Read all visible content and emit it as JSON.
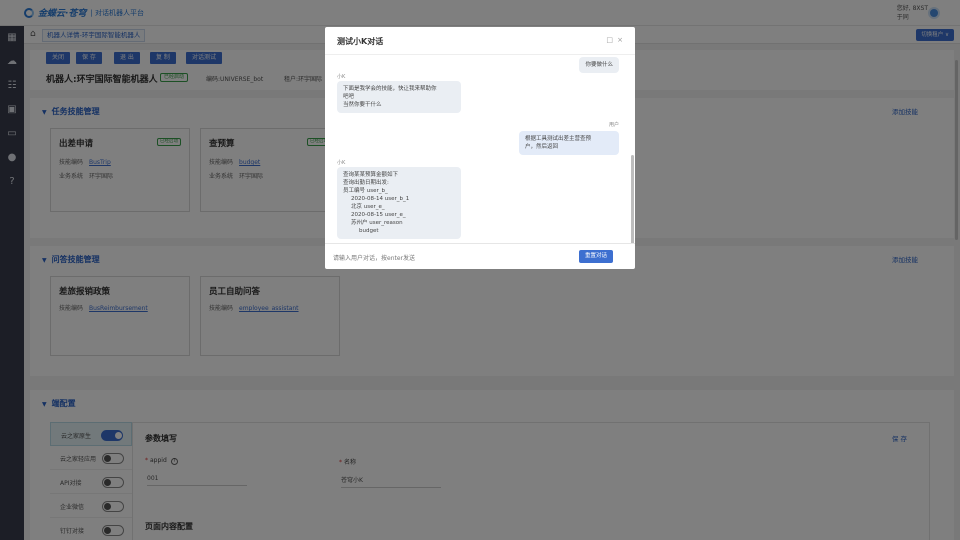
{
  "topbar": {
    "logo_text": "金蝶云·苍穹",
    "logo_sub": "| 对话机器人平台",
    "user_line1": "您好, 8XST",
    "user_line2": "于同"
  },
  "sidebar": {
    "icons": [
      "grid-icon",
      "cloud-icon",
      "database-icon",
      "bot-icon",
      "monitor-icon",
      "user-icon",
      "help-icon"
    ]
  },
  "header": {
    "tab_label": "机器人详情-环宇国际智能机器人",
    "switch_button": "切换租户 ∨"
  },
  "toolbar": {
    "buttons": [
      "关闭",
      "保 存",
      "退 出",
      "复 制",
      "对话测试"
    ],
    "robot_title": "机器人:环宇国际智能机器人",
    "status": "已经启动",
    "code_label": "编码:UNIVERSE_bot",
    "tenant_label": "租户:环宇国际"
  },
  "task_panel": {
    "title": "任务技能管理",
    "add_link": "添加技能",
    "cards": [
      {
        "title": "出差申请",
        "tag": "已经启动",
        "code_label": "技能编码",
        "code": "BusTrip",
        "system_label": "业务系统",
        "system": "环宇国际"
      },
      {
        "title": "查预算",
        "tag": "已经启动",
        "code_label": "技能编码",
        "code": "budget",
        "system_label": "业务系统",
        "system": "环宇国际"
      }
    ]
  },
  "qa_panel": {
    "title": "问答技能管理",
    "add_link": "添加技能",
    "cards": [
      {
        "title": "差旅报销政策",
        "code_label": "技能编码",
        "code": "BusReimbursement"
      },
      {
        "title": "员工自助问答",
        "code_label": "技能编码",
        "code": "employee_assistant"
      }
    ]
  },
  "config_panel": {
    "title": "端配置",
    "items": [
      {
        "label": "云之家原生",
        "on": true
      },
      {
        "label": "云之家轻应用",
        "on": false
      },
      {
        "label": "API对接",
        "on": false
      },
      {
        "label": "企业微信",
        "on": false
      },
      {
        "label": "钉钉对接",
        "on": false
      }
    ],
    "param_title": "参数填写",
    "save": "保 存",
    "appid_label": "appid",
    "appid_value": "001",
    "name_label": "名称",
    "name_value": "苍穹小K",
    "page_config": "页面内容配置"
  },
  "modal": {
    "title": "测试小K对话",
    "messages": [
      {
        "from": "bot",
        "who": "",
        "text": "你要做什么"
      },
      {
        "from": "bot",
        "who": "小K",
        "lines": [
          "下面是我学会的技能，快让我来帮助你",
          "吧吧",
          "当然你要干什么"
        ]
      },
      {
        "from": "user",
        "who": "用户",
        "lines": [
          "根据工具测试出差主营查预",
          "户，然后返回"
        ]
      },
      {
        "from": "bot",
        "who": "小K",
        "lines": [
          "查询某某预算金额如下",
          "查询出勤日期出发:",
          "员工编号 user_b_",
          "2020-08-14  user_b_1",
          "北京  user_e_",
          "2020-08-15  user_e_",
          "苏州户  user_reason",
          "budget"
        ]
      }
    ],
    "input_placeholder": "请输入用户对话，按enter发送",
    "send_button": "重置对话"
  }
}
